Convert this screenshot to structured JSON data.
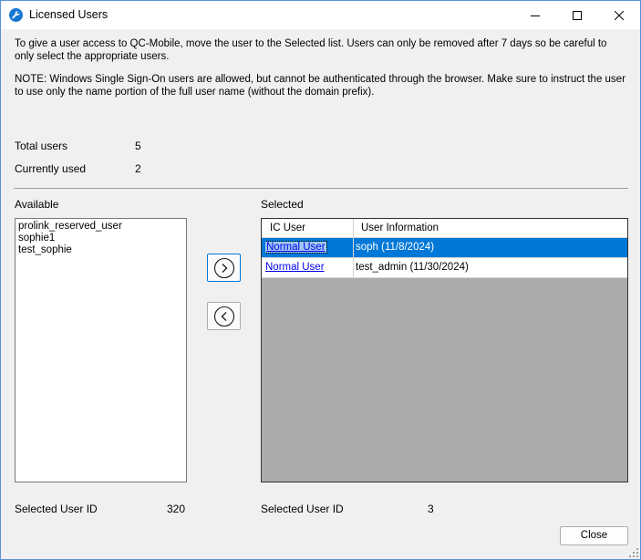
{
  "window": {
    "title": "Licensed Users",
    "icon": "wrench-icon"
  },
  "intro_text": "To give a user access to QC-Mobile, move the user to the Selected list. Users can only be removed after 7 days so be careful to only select the appropriate users.",
  "note_text": "NOTE: Windows Single Sign-On users are allowed, but cannot be authenticated through the browser. Make sure to instruct the user to use only the name portion of the full user name (without the domain prefix).",
  "stats": {
    "total_users_label": "Total users",
    "total_users_value": "5",
    "currently_used_label": "Currently used",
    "currently_used_value": "2"
  },
  "available": {
    "label": "Available",
    "items": [
      "prolink_reserved_user",
      "sophie1",
      "test_sophie"
    ],
    "selected_user_id_label": "Selected User ID",
    "selected_user_id_value": "320"
  },
  "selected": {
    "label": "Selected",
    "columns": [
      "IC User",
      "User Information"
    ],
    "rows": [
      {
        "ic_user": "Normal User",
        "info": "soph (11/8/2024)",
        "selected": true
      },
      {
        "ic_user": "Normal User",
        "info": "test_admin (11/30/2024)",
        "selected": false
      }
    ],
    "selected_user_id_label": "Selected User ID",
    "selected_user_id_value": "3"
  },
  "buttons": {
    "add_icon": "chevron-right-circle-icon",
    "remove_icon": "chevron-left-circle-icon",
    "close_label": "Close"
  },
  "colors": {
    "selection": "#0078d7",
    "grid_background": "#ababab",
    "link": "#0000ee"
  }
}
